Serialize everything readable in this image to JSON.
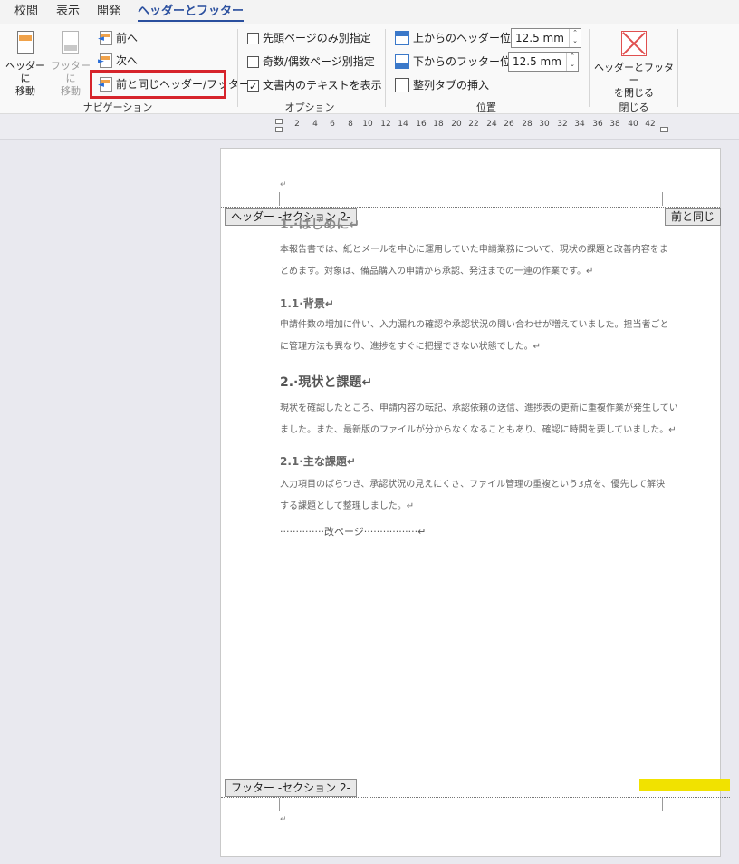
{
  "tabs": [
    "校閲",
    "表示",
    "開発",
    "ヘッダーとフッター"
  ],
  "ribbon": {
    "navigation": {
      "goto_header": "ヘッダーに\n移動",
      "goto_footer": "フッターに\n移動",
      "prev": "前へ",
      "next": "次へ",
      "link_previous": "前と同じヘッダー/フッター",
      "label": "ナビゲーション"
    },
    "options": {
      "first_page": "先頭ページのみ別指定",
      "odd_even": "奇数/偶数ページ別指定",
      "show_text": "文書内のテキストを表示",
      "first_page_checked": false,
      "odd_even_checked": false,
      "show_text_checked": true,
      "label": "オプション"
    },
    "position": {
      "header_from_top": "上からのヘッダー位置:",
      "header_value": "12.5 mm",
      "footer_from_bottom": "下からのフッター位置:",
      "footer_value": "12.5 mm",
      "insert_tab": "整列タブの挿入",
      "label": "位置"
    },
    "close": {
      "button": "ヘッダーとフッター\nを閉じる",
      "label": "閉じる"
    }
  },
  "ruler": [
    "2",
    "4",
    "6",
    "8",
    "10",
    "12",
    "14",
    "16",
    "18",
    "20",
    "22",
    "24",
    "26",
    "28",
    "30",
    "32",
    "34",
    "36",
    "38",
    "40",
    "42"
  ],
  "page": {
    "header_tag": "ヘッダー -セクション 2-",
    "same_as_previous": "前と同じ",
    "footer_tag": "フッター -セクション 2-",
    "heading1": "1.·はじめに↵",
    "para1": "本報告書では、紙とメールを中心に運用していた申請業務について、現状の課題と改善内容をまとめます。対象は、備品購入の申請から承認、発注までの一連の作業です。↵",
    "heading1_1": "1.1·背景↵",
    "para2": "申請件数の増加に伴い、入力漏れの確認や承認状況の問い合わせが増えていました。担当者ごとに管理方法も異なり、進捗をすぐに把握できない状態でした。↵",
    "heading2": "2.·現状と課題↵",
    "para3": "現状を確認したところ、申請内容の転記、承認依頼の送信、進捗表の更新に重複作業が発生していました。また、最新版のファイルが分からなくなることもあり、確認に時間を要していました。↵",
    "heading2_1": "2.1·主な課題↵",
    "para4": "入力項目のばらつき、承認状況の見えにくさ、ファイル管理の重複という3点を、優先して解決する課題として整理しました。↵",
    "page_break": "··············改ページ·················↵",
    "return_mark": "↵"
  },
  "colors": {
    "accent": "#2a4f9e",
    "highlight": "#f1e200",
    "redbox": "#d6242b"
  }
}
